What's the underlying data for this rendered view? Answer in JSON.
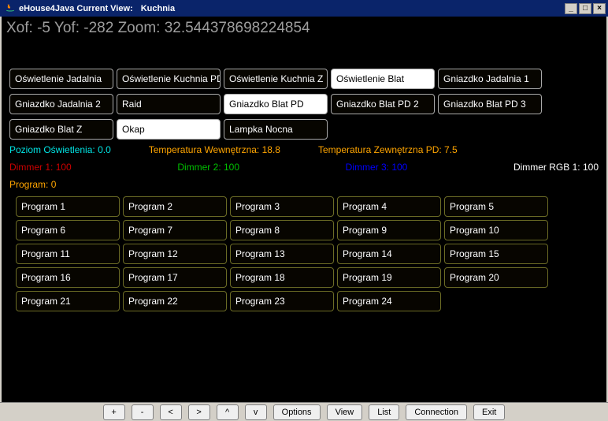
{
  "title": {
    "app": "eHouse4Java Current View:",
    "view": "Kuchnia"
  },
  "coords": {
    "xof": -5,
    "yof": -282,
    "zoom": "32.544378698224854"
  },
  "devices": [
    {
      "label": "Oświetlenie Jadalnia",
      "active": false
    },
    {
      "label": "Oświetlenie Kuchnia PD",
      "active": false
    },
    {
      "label": "Oświetlenie Kuchnia  Z",
      "active": false
    },
    {
      "label": "Oświetlenie Blat",
      "active": true
    },
    {
      "label": "Gniazdko Jadalnia 1",
      "active": false
    },
    {
      "label": "Gniazdko Jadalnia 2",
      "active": false
    },
    {
      "label": "Raid",
      "active": false
    },
    {
      "label": "Gniazdko Blat PD",
      "active": true
    },
    {
      "label": "Gniazdko Blat PD 2",
      "active": false
    },
    {
      "label": "Gniazdko Blat PD 3",
      "active": false
    },
    {
      "label": "Gniazdko Blat Z",
      "active": false
    },
    {
      "label": "Okap",
      "active": true
    },
    {
      "label": "Lampka Nocna",
      "active": false
    }
  ],
  "status": {
    "light_level": {
      "label": "Poziom Oświetlenia:",
      "value": "0.0"
    },
    "temp_in": {
      "label": "Temperatura Wewnętrzna:",
      "value": "18.8"
    },
    "temp_out": {
      "label": "Temperatura Zewnętrzna PD:",
      "value": "7.5"
    }
  },
  "dimmers": {
    "d1": {
      "label": "Dimmer 1:",
      "value": "100"
    },
    "d2": {
      "label": "Dimmer 2:",
      "value": "100"
    },
    "d3": {
      "label": "Dimmer 3:",
      "value": "100"
    },
    "rgb": {
      "label": "Dimmer RGB 1:",
      "value": "100"
    }
  },
  "program_current": {
    "label": "Program:",
    "value": "0"
  },
  "programs": [
    "Program 1",
    "Program 2",
    "Program 3",
    "Program 4",
    "Program 5",
    "Program 6",
    "Program 7",
    "Program 8",
    "Program 9",
    "Program 10",
    "Program 11",
    "Program 12",
    "Program 13",
    "Program 14",
    "Program 15",
    "Program 16",
    "Program 17",
    "Program 18",
    "Program 19",
    "Program 20",
    "Program 21",
    "Program 22",
    "Program 23",
    "Program 24"
  ],
  "toolbar": {
    "plus": "+",
    "minus": "-",
    "left": "<",
    "right": ">",
    "up": "^",
    "down": "v",
    "options": "Options",
    "view": "View",
    "list": "List",
    "connection": "Connection",
    "exit": "Exit"
  },
  "winctrl": {
    "min": "_",
    "max": "□",
    "close": "×"
  }
}
